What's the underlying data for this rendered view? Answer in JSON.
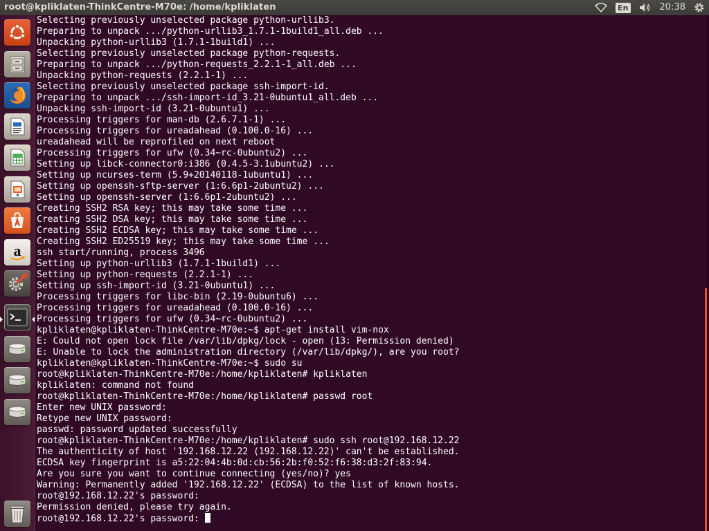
{
  "topbar": {
    "window_title": "root@kpliklaten-ThinkCentre-M70e: /home/kpliklaten",
    "language": "En",
    "clock": "20:38",
    "icons": [
      "wifi-icon",
      "volume-icon",
      "gear-icon"
    ]
  },
  "launcher": {
    "items": [
      {
        "name": "dash-home",
        "icon": "ubuntu-logo-icon"
      },
      {
        "name": "files",
        "icon": "file-cabinet-icon"
      },
      {
        "name": "firefox",
        "icon": "firefox-icon"
      },
      {
        "name": "libreoffice-writer",
        "icon": "writer-icon"
      },
      {
        "name": "libreoffice-calc",
        "icon": "calc-icon"
      },
      {
        "name": "libreoffice-impress",
        "icon": "impress-icon"
      },
      {
        "name": "software-center",
        "icon": "software-center-icon"
      },
      {
        "name": "amazon",
        "icon": "amazon-icon"
      },
      {
        "name": "system-settings",
        "icon": "settings-wrench-icon"
      },
      {
        "name": "terminal",
        "icon": "terminal-icon",
        "active": true
      },
      {
        "name": "drive-1",
        "icon": "hard-drive-icon"
      },
      {
        "name": "drive-2",
        "icon": "hard-drive-icon"
      },
      {
        "name": "drive-3",
        "icon": "hard-drive-icon"
      },
      {
        "name": "trash",
        "icon": "trash-icon"
      }
    ]
  },
  "colors": {
    "terminal_bg": "#300a24",
    "terminal_fg": "#ffffff",
    "accent": "#e95420",
    "panel_bg": "#3c3b37"
  },
  "terminal": {
    "lines": [
      "Selecting previously unselected package python-urllib3.",
      "Preparing to unpack .../python-urllib3_1.7.1-1build1_all.deb ...",
      "Unpacking python-urllib3 (1.7.1-1build1) ...",
      "Selecting previously unselected package python-requests.",
      "Preparing to unpack .../python-requests_2.2.1-1_all.deb ...",
      "Unpacking python-requests (2.2.1-1) ...",
      "Selecting previously unselected package ssh-import-id.",
      "Preparing to unpack .../ssh-import-id_3.21-0ubuntu1_all.deb ...",
      "Unpacking ssh-import-id (3.21-0ubuntu1) ...",
      "Processing triggers for man-db (2.6.7.1-1) ...",
      "Processing triggers for ureadahead (0.100.0-16) ...",
      "ureadahead will be reprofiled on next reboot",
      "Processing triggers for ufw (0.34~rc-0ubuntu2) ...",
      "Setting up libck-connector0:i386 (0.4.5-3.1ubuntu2) ...",
      "Setting up ncurses-term (5.9+20140118-1ubuntu1) ...",
      "Setting up openssh-sftp-server (1:6.6p1-2ubuntu2) ...",
      "Setting up openssh-server (1:6.6p1-2ubuntu2) ...",
      "Creating SSH2 RSA key; this may take some time ...",
      "Creating SSH2 DSA key; this may take some time ...",
      "Creating SSH2 ECDSA key; this may take some time ...",
      "Creating SSH2 ED25519 key; this may take some time ...",
      "ssh start/running, process 3496",
      "Setting up python-urllib3 (1.7.1-1build1) ...",
      "Setting up python-requests (2.2.1-1) ...",
      "Setting up ssh-import-id (3.21-0ubuntu1) ...",
      "Processing triggers for libc-bin (2.19-0ubuntu6) ...",
      "Processing triggers for ureadahead (0.100.0-16) ...",
      "Processing triggers for ufw (0.34~rc-0ubuntu2) ...",
      "kpliklaten@kpliklaten-ThinkCentre-M70e:~$ apt-get install vim-nox",
      "E: Could not open lock file /var/lib/dpkg/lock - open (13: Permission denied)",
      "E: Unable to lock the administration directory (/var/lib/dpkg/), are you root?",
      "kpliklaten@kpliklaten-ThinkCentre-M70e:~$ sudo su",
      "root@kpliklaten-ThinkCentre-M70e:/home/kpliklaten# kpliklaten",
      "kpliklaten: command not found",
      "root@kpliklaten-ThinkCentre-M70e:/home/kpliklaten# passwd root",
      "Enter new UNIX password:",
      "Retype new UNIX password:",
      "passwd: password updated successfully",
      "root@kpliklaten-ThinkCentre-M70e:/home/kpliklaten# sudo ssh root@192.168.12.22",
      "The authenticity of host '192.168.12.22 (192.168.12.22)' can't be established.",
      "ECDSA key fingerprint is a5:22:04:4b:0d:cb:56:2b:f0:52:f6:38:d3:2f:83:94.",
      "Are you sure you want to continue connecting (yes/no)? yes",
      "Warning: Permanently added '192.168.12.22' (ECDSA) to the list of known hosts.",
      "root@192.168.12.22's password:",
      "Permission denied, please try again."
    ],
    "prompt_line": "root@192.168.12.22's password: "
  }
}
